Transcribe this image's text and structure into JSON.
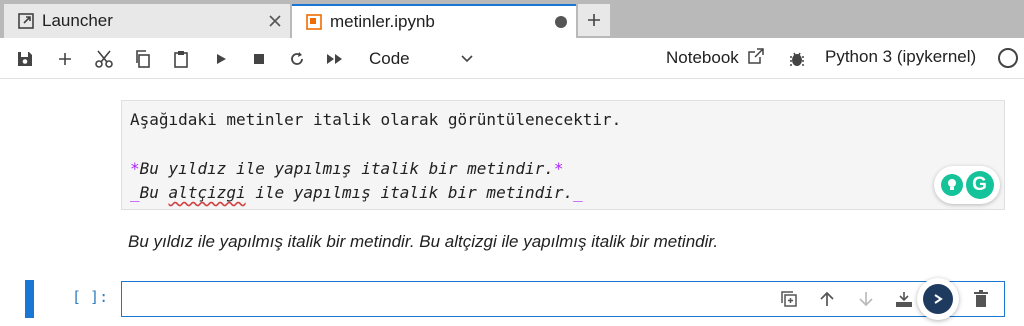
{
  "tabs": [
    {
      "label": "Launcher",
      "icon": "launcher-icon",
      "active": false
    },
    {
      "label": "metinler.ipynb",
      "icon": "notebook-icon",
      "active": true,
      "unsaved": true
    }
  ],
  "toolbar": {
    "buttons": [
      "save-icon",
      "add-icon",
      "cut-icon",
      "copy-icon",
      "paste-icon",
      "run-icon",
      "stop-icon",
      "restart-icon",
      "fast-forward-icon"
    ],
    "cell_type": "Code",
    "notebook_label": "Notebook",
    "kernel_label": "Python 3 (ipykernel)"
  },
  "markdown_cell": {
    "line1": "Aşağıdaki metinler italik olarak görüntülenecektir.",
    "line2_mark": "*",
    "line2_text": "Bu yıldız ile yapılmış italik bir metindir.",
    "line3_mark": "_",
    "line3_pre": "Bu ",
    "line3_word": "altçizgi",
    "line3_post": " ile yapılmış italik bir metindir.",
    "rendered": "Bu yıldız ile yapılmış italik bir metindir. Bu altçizgi ile yapılmış italik bir metindir."
  },
  "code_cell": {
    "prompt": "[ ]:",
    "tools": [
      "duplicate-icon",
      "move-up-icon",
      "move-down-icon",
      "insert-below-icon",
      "delete-icon"
    ]
  },
  "colors": {
    "accent": "#1976d2",
    "markdown_marker": "#aa22ff",
    "grammarly": "#15c39a"
  }
}
